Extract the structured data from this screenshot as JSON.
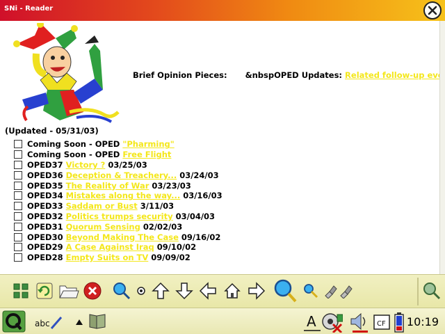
{
  "window": {
    "title": "SNi - Reader"
  },
  "header": {
    "label": "Brief Opinion Pieces:",
    "updates_label": "&nbspOPED Updates:",
    "updates_link": "Related follow-up events."
  },
  "updated": "(Updated - 05/31/03)",
  "items": [
    {
      "prefix": "Coming Soon - OPED",
      "link": "\"Pharming\"",
      "date": ""
    },
    {
      "prefix": "Coming Soon - OPED",
      "link": "Free Flight",
      "date": ""
    },
    {
      "prefix": "OPED37",
      "link": "Victory ?",
      "date": "03/25/03"
    },
    {
      "prefix": "OPED36",
      "link": "Deception & Treachery...",
      "date": "03/24/03"
    },
    {
      "prefix": "OPED35",
      "link": "The Reality of War",
      "date": "03/23/03"
    },
    {
      "prefix": "OPED34",
      "link": "Mistakes along the way...",
      "date": "03/16/03"
    },
    {
      "prefix": "OPED33",
      "link": "Saddam or Bust",
      "date": "3/11/03"
    },
    {
      "prefix": "OPED32",
      "link": "Politics trumps security",
      "date": "03/04/03"
    },
    {
      "prefix": "OPED31",
      "link": "Quorum Sensing",
      "date": "02/02/03"
    },
    {
      "prefix": "OPED30",
      "link": "Beyond Making The Case",
      "date": "09/16/02"
    },
    {
      "prefix": "OPED29",
      "link": "A Case Against Iraq",
      "date": "09/10/02"
    },
    {
      "prefix": "OPED28",
      "link": "Empty Suits on TV",
      "date": "09/09/02"
    }
  ],
  "toolbar": {
    "icons": [
      "grid-icon",
      "refresh-icon",
      "folder-open-icon",
      "stop-icon",
      "zoom-icon",
      "small-bullet-icon",
      "arrow-up-icon",
      "arrow-down-icon",
      "arrow-left-icon",
      "home-icon",
      "arrow-right-icon",
      "search-large-icon",
      "find-small-icon",
      "pin-icon",
      "pin-alt-icon",
      "magnifier-icon"
    ]
  },
  "taskbar": {
    "clock": "10:19",
    "tray": [
      "qtopia-logo-icon",
      "handwriting-icon",
      "up-triangle-icon",
      "book-icon",
      "text-cursor-icon",
      "network-disabled-icon",
      "speaker-icon",
      "cf-card-icon",
      "battery-icon"
    ],
    "cf_label": "CF"
  },
  "colors": {
    "link": "#f4e71a",
    "titlebar_start": "#d0102a",
    "titlebar_end": "#f6c21a",
    "toolbar_bg": "#ecebb5"
  }
}
